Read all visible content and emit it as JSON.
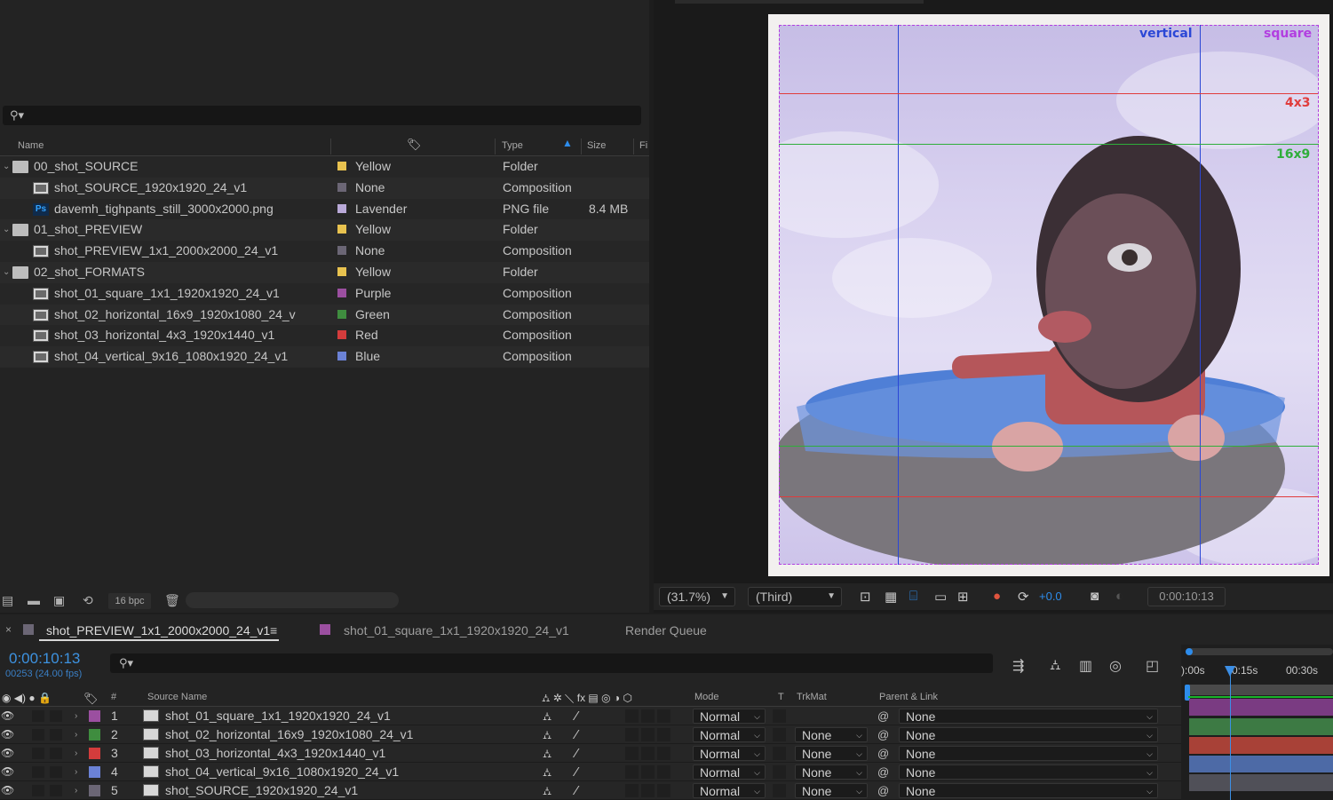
{
  "project": {
    "columns": {
      "name": "Name",
      "type": "Type",
      "size": "Size",
      "frame": "Fi"
    },
    "items": [
      {
        "name": "00_shot_SOURCE",
        "kind": "folder",
        "label": "Yellow",
        "type": "Folder",
        "size": "",
        "color": "#e8c24f"
      },
      {
        "name": "shot_SOURCE_1920x1920_24_v1",
        "kind": "comp",
        "label": "None",
        "type": "Composition",
        "size": "",
        "color": "#6b6675"
      },
      {
        "name": "davemh_tighpants_still_3000x2000.png",
        "kind": "psd",
        "label": "Lavender",
        "type": "PNG file",
        "size": "8.4 MB",
        "color": "#b9a9d8"
      },
      {
        "name": "01_shot_PREVIEW",
        "kind": "folder",
        "label": "Yellow",
        "type": "Folder",
        "size": "",
        "color": "#e8c24f"
      },
      {
        "name": "shot_PREVIEW_1x1_2000x2000_24_v1",
        "kind": "comp",
        "label": "None",
        "type": "Composition",
        "size": "",
        "color": "#6b6675"
      },
      {
        "name": "02_shot_FORMATS",
        "kind": "folder",
        "label": "Yellow",
        "type": "Folder",
        "size": "",
        "color": "#e8c24f"
      },
      {
        "name": "shot_01_square_1x1_1920x1920_24_v1",
        "kind": "comp",
        "label": "Purple",
        "type": "Composition",
        "size": "",
        "color": "#9b4fa0"
      },
      {
        "name": "shot_02_horizontal_16x9_1920x1080_24_v",
        "kind": "comp",
        "label": "Green",
        "type": "Composition",
        "size": "",
        "color": "#3f8d3f"
      },
      {
        "name": "shot_03_horizontal_4x3_1920x1440_v1",
        "kind": "comp",
        "label": "Red",
        "type": "Composition",
        "size": "",
        "color": "#d43c3c"
      },
      {
        "name": "shot_04_vertical_9x16_1080x1920_24_v1",
        "kind": "comp",
        "label": "Blue",
        "type": "Composition",
        "size": "",
        "color": "#6b82d6"
      }
    ],
    "footer": {
      "bpc": "16 bpc"
    }
  },
  "viewer": {
    "guides": {
      "vertical": "vertical",
      "square": "square",
      "four_three": "4x3",
      "sixteen_nine": "16x9"
    },
    "colors": {
      "vertical": "#2b47d6",
      "square": "#b23ee0",
      "four_three": "#e03c3c",
      "sixteen_nine": "#2fae3a"
    },
    "controls": {
      "zoom": "(31.7%)",
      "resolution": "(Third)",
      "exposure": "+0.0",
      "timecode": "0:00:10:13"
    }
  },
  "timeline": {
    "tabs": [
      {
        "label": "shot_PREVIEW_1x1_2000x2000_24_v1",
        "color": "#6b6675"
      },
      {
        "label": "shot_01_square_1x1_1920x1920_24_v1",
        "color": "#9b4fa0"
      },
      {
        "label": "Render Queue"
      }
    ],
    "timecode": "0:00:10:13",
    "fps": "00253 (24.00 fps)",
    "columns": {
      "num": "#",
      "source": "Source Name",
      "mode": "Mode",
      "t": "T",
      "trkmat": "TrkMat",
      "parent": "Parent & Link"
    },
    "ruler": [
      "):00s",
      "0:15s",
      "00:30s"
    ],
    "layers": [
      {
        "num": "1",
        "name": "shot_01_square_1x1_1920x1920_24_v1",
        "mode": "Normal",
        "trkmat": "",
        "parent": "None",
        "color": "#9b4fa0",
        "bar": "#7a3b82"
      },
      {
        "num": "2",
        "name": "shot_02_horizontal_16x9_1920x1080_24_v1",
        "mode": "Normal",
        "trkmat": "None",
        "parent": "None",
        "color": "#3f8d3f",
        "bar": "#3d7a44"
      },
      {
        "num": "3",
        "name": "shot_03_horizontal_4x3_1920x1440_v1",
        "mode": "Normal",
        "trkmat": "None",
        "parent": "None",
        "color": "#d43c3c",
        "bar": "#a84137"
      },
      {
        "num": "4",
        "name": "shot_04_vertical_9x16_1080x1920_24_v1",
        "mode": "Normal",
        "trkmat": "None",
        "parent": "None",
        "color": "#6b82d6",
        "bar": "#4d6aa6"
      },
      {
        "num": "5",
        "name": "shot_SOURCE_1920x1920_24_v1",
        "mode": "Normal",
        "trkmat": "None",
        "parent": "None",
        "color": "#6b6675",
        "bar": "#505058"
      }
    ]
  }
}
